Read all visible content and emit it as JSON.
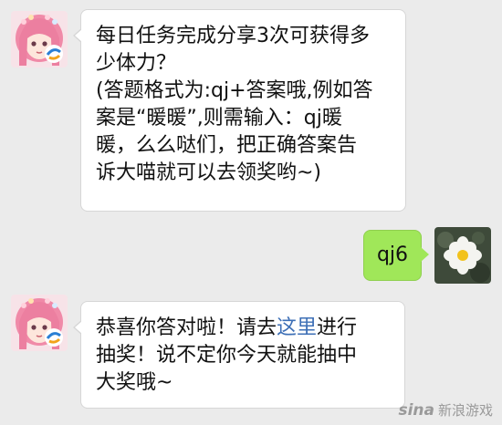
{
  "messages": [
    {
      "sender": "bot",
      "lines": [
        "每日任务完成分享3次可获得多",
        "少体力？",
        "(答题格式为:qj+答案哦,例如答",
        "案是“暖暖”,则需输入：qj暖",
        "暖，么么哒们，把正确答案告",
        "诉大喵就可以去领奖哟~)"
      ]
    },
    {
      "sender": "user",
      "text": "qj6"
    },
    {
      "sender": "bot",
      "line1_before": "恭喜你答对啦！请去",
      "line1_link": "这里",
      "line1_after": "进行",
      "line2": "抽奖！说不定你今天就能抽中",
      "line3": "大奖哦~"
    }
  ],
  "watermark": {
    "logo": "sina",
    "text": "新浪游戏"
  },
  "colors": {
    "background": "#ebebeb",
    "incoming_bubble": "#ffffff",
    "outgoing_bubble": "#a0e759",
    "link": "#3d6fb6"
  },
  "icons": {
    "bot_avatar": "anime-girl-avatar",
    "bot_badge": "tencent-game-badge-icon",
    "user_avatar": "white-flower-avatar"
  }
}
